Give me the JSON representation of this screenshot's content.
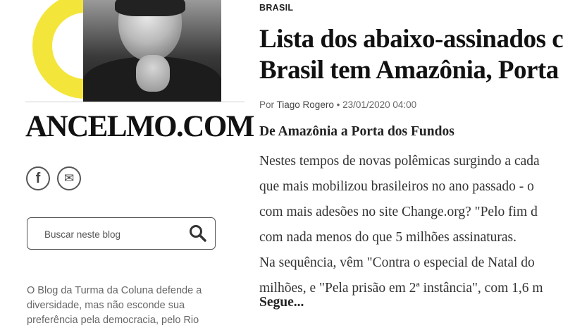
{
  "sidebar": {
    "brand": "ANCELMO.COM",
    "social": {
      "facebook_glyph": "f",
      "email_glyph": "✉"
    },
    "search": {
      "placeholder": "Buscar neste blog"
    },
    "about_lines": [
      "O Blog da Turma da Coluna defende a",
      "diversidade, mas não esconde sua",
      "preferência pela democracia, pelo Rio"
    ]
  },
  "article": {
    "section": "BRASIL",
    "headline_lines": [
      "Lista dos abaixo-assinados com",
      "Brasil tem Amazônia, Porta dos"
    ],
    "byline": {
      "prefix": "Por",
      "author": "Tiago Rogero",
      "date": "• 23/01/2020 04:00"
    },
    "subhead": "De Amazônia a Porta dos Fundos",
    "body_lines": [
      "Nestes tempos de novas polêmicas surgindo a cada",
      "que mais mobilizou brasileiros no ano passado - o",
      "com mais adesões no site Change.org? \"Pelo fim d",
      "com nada menos do que 5 milhões assinaturas.",
      "Na sequência, vêm \"Contra o especial de Natal do",
      "milhões, e \"Pela prisão em 2ª instância\", com 1,6 m"
    ],
    "more_link": "Segue..."
  },
  "colors": {
    "accent_yellow": "#f4e53a",
    "text": "#222222",
    "muted": "#666666"
  },
  "icons": [
    "facebook-icon",
    "email-icon",
    "search-icon"
  ]
}
